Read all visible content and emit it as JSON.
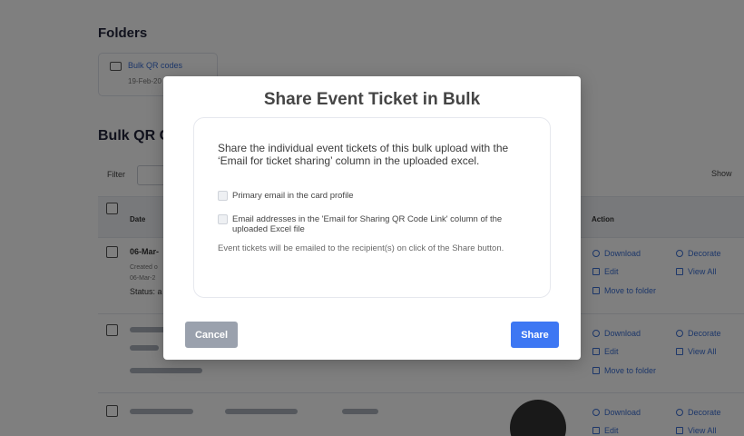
{
  "background": {
    "folders_title": "Folders",
    "folder": {
      "name": "Bulk QR codes",
      "date": "19-Feb-20"
    },
    "bulk_title": "Bulk QR C",
    "filter_label": "Filter",
    "show_label": "Show",
    "table": {
      "col_date": "Date",
      "col_action": "Action"
    },
    "row1": {
      "date": "06-Mar-",
      "created": "Created o",
      "created_date": "06-Mar-2",
      "status": "Status: a"
    },
    "actions": {
      "download": "Download",
      "decorate": "Decorate",
      "edit": "Edit",
      "view_all": "View All",
      "move": "Move to folder"
    }
  },
  "modal": {
    "title": "Share Event Ticket in Bulk",
    "intro": "Share the individual event tickets of this bulk upload with the ‘Email for ticket sharing’ column in the uploaded excel.",
    "options": [
      {
        "label": "Primary email in the card profile",
        "checked": false
      },
      {
        "label": "Email addresses in the 'Email for Sharing QR Code Link' column of the uploaded Excel file",
        "checked": false
      }
    ],
    "note": "Event tickets will be emailed to the recipient(s) on click of the Share button.",
    "cancel_label": "Cancel",
    "share_label": "Share"
  },
  "colors": {
    "primary": "#3d77f3",
    "cancel": "#9aa1ad",
    "link": "#3b6fd4",
    "overlay": "rgba(0,0,0,0.5)"
  }
}
